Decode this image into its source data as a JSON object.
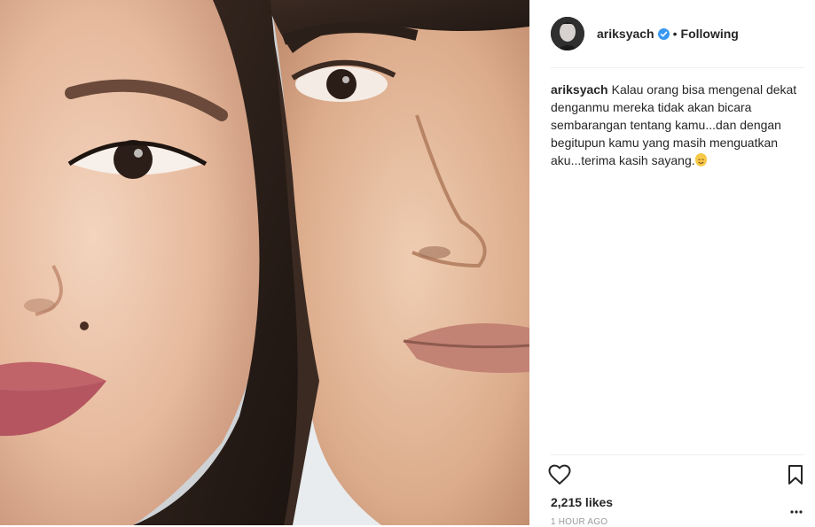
{
  "post": {
    "username": "ariksyach",
    "follow_status": "Following",
    "separator": "•",
    "caption_username": "ariksyach",
    "caption_text": "Kalau orang bisa mengenal dekat denganmu mereka tidak akan bicara sembarangan tentang kamu...dan dengan begitupun kamu yang masih menguatkan aku...terima kasih sayang.",
    "likes": "2,215 likes",
    "timestamp": "1 HOUR AGO"
  },
  "icons": {
    "verified": "verified-badge-icon",
    "like": "heart-icon",
    "save": "bookmark-icon",
    "more": "more-options-icon",
    "emoji": "smiling-face-emoji-icon"
  },
  "colors": {
    "verified_blue": "#3897f0",
    "text": "#262626",
    "muted": "#999999",
    "divider": "#efefef"
  }
}
